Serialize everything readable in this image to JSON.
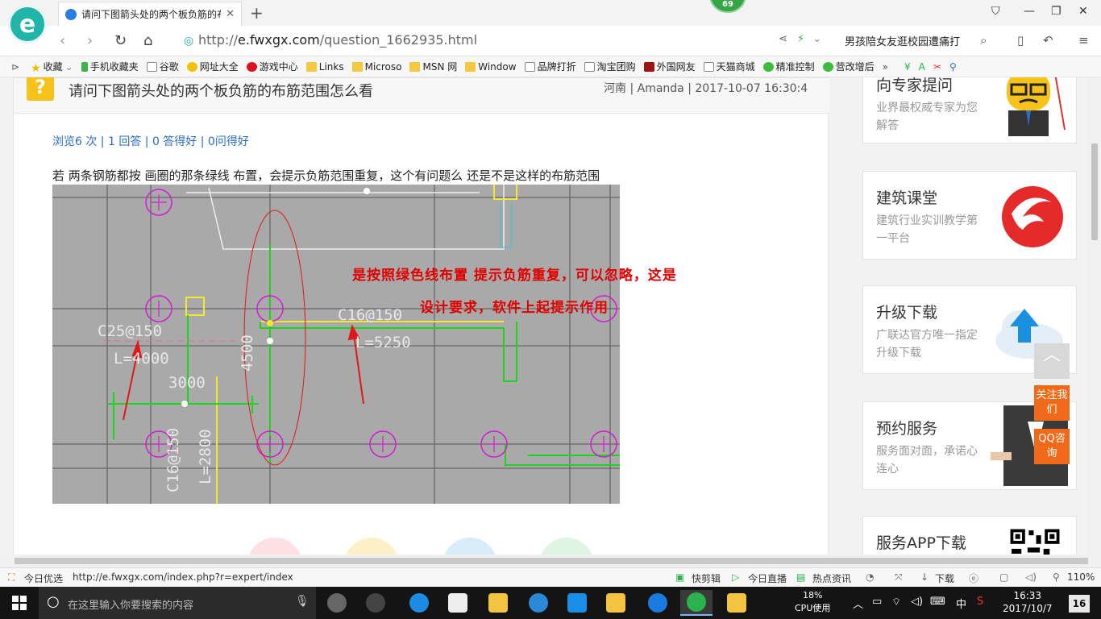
{
  "browser": {
    "tab_title": "请问下图箭头处的两个板负筋的布",
    "badge": "69",
    "url_prefix": "http://",
    "url_domain": "e.fwxgx.com",
    "url_path": "/question_1662935.html",
    "search_text": "男孩陪女友逛校园遭痛打"
  },
  "bookmarks": [
    {
      "label": "收藏",
      "icon": "star"
    },
    {
      "label": "手机收藏夹",
      "icon": "phone"
    },
    {
      "label": "谷歌",
      "icon": "page"
    },
    {
      "label": "网址大全",
      "icon": "yellow"
    },
    {
      "label": "游戏中心",
      "icon": "red"
    },
    {
      "label": "Links",
      "icon": "folder"
    },
    {
      "label": "Microso",
      "icon": "folder"
    },
    {
      "label": "MSN 网",
      "icon": "folder"
    },
    {
      "label": "Window",
      "icon": "folder"
    },
    {
      "label": "品牌打折",
      "icon": "page"
    },
    {
      "label": "淘宝团购",
      "icon": "page"
    },
    {
      "label": "外国网友",
      "icon": "maroon"
    },
    {
      "label": "天猫商城",
      "icon": "page"
    },
    {
      "label": "精准控制",
      "icon": "green"
    },
    {
      "label": "营改增后",
      "icon": "green"
    }
  ],
  "question": {
    "title": "请问下图箭头处的两个板负筋的布筋范围怎么看",
    "meta": "河南 | Amanda | 2017-10-07 16:30:4",
    "stats": "浏览6 次 | 1 回答 | 0 答得好 | 0问得好",
    "text": "若 两条钢筋都按 画圈的那条绿线 布置，会提示负筋范围重复，这个有问题么  还是不是这样的布筋范围"
  },
  "cad": {
    "labels": {
      "c25": "C25@150",
      "l4000": "L=4000",
      "d3000": "3000",
      "d4500": "4500",
      "c16a": "C16@150",
      "l5250": "L=5250",
      "c16b": "C16@150",
      "l2800": "L=2800"
    },
    "annotation_line1": "是按照绿色线布置   提示负筋重复，可以忽略，这是",
    "annotation_line2": "设计要求，软件上起提示作用"
  },
  "sidebar": [
    {
      "title": "向专家提问",
      "desc": "业界最权威专家为您解答"
    },
    {
      "title": "建筑课堂",
      "desc": "建筑行业实训教学第一平台"
    },
    {
      "title": "升级下载",
      "desc": "广联达官方唯一指定升级下载"
    },
    {
      "title": "预约服务",
      "desc": "服务面对面，承诺心连心"
    },
    {
      "title": "服务APP下载",
      "desc": ""
    }
  ],
  "float_buttons": {
    "follow": "关注我们",
    "qq": "QQ咨询"
  },
  "status": {
    "today": "今日优选",
    "link": "http://e.fwxgx.com/index.php?r=expert/index",
    "quick": "快剪辑",
    "live": "今日直播",
    "news": "热点资讯",
    "download": "下载",
    "zoom": "110%"
  },
  "taskbar": {
    "search_placeholder": "在这里输入你要搜索的内容",
    "cpu_value": "18%",
    "cpu_label": "CPU使用",
    "ime": "中",
    "time": "16:33",
    "date": "2017/10/7",
    "notif": "16"
  }
}
